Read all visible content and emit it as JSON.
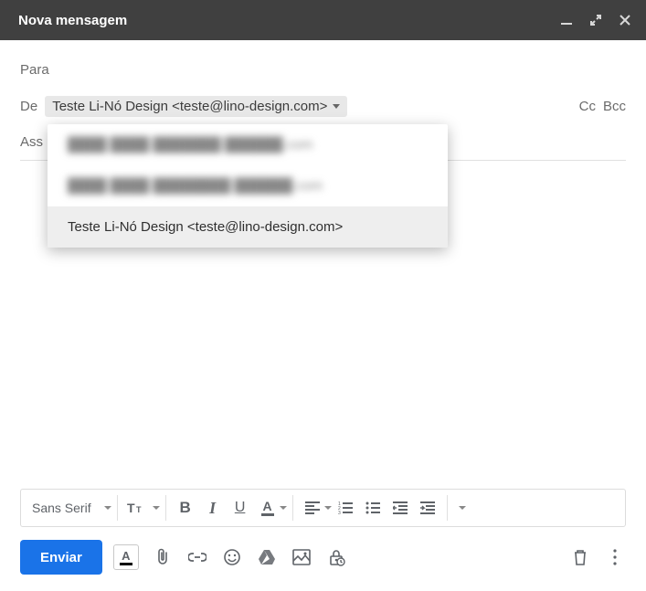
{
  "window": {
    "title": "Nova mensagem"
  },
  "fields": {
    "to_label": "Para",
    "from_label": "De",
    "subject_label": "Ass",
    "cc_label": "Cc",
    "bcc_label": "Bcc",
    "from_selected": "Teste Li-Nó Design <teste@lino-design.com>"
  },
  "from_dropdown": {
    "options": [
      {
        "label": "████ ████ ███████ ██████.com",
        "blurred": true
      },
      {
        "label": "████ ████ ████████ ██████.com",
        "blurred": true
      },
      {
        "label": "Teste Li-Nó Design <teste@lino-design.com>",
        "selected": true
      }
    ]
  },
  "format_toolbar": {
    "font": "Sans Serif"
  },
  "actions": {
    "send": "Enviar"
  },
  "icons": {
    "minimize": "minimize-icon",
    "expand": "expand-icon",
    "close": "close-icon",
    "chevron_down": "chevron-down-icon",
    "text_size": "text-size-icon",
    "bold": "bold-icon",
    "italic": "italic-icon",
    "underline": "underline-icon",
    "text_color": "text-color-icon",
    "align": "align-icon",
    "list_numbered": "numbered-list-icon",
    "list_bulleted": "bulleted-list-icon",
    "indent_decrease": "indent-decrease-icon",
    "indent_increase": "indent-increase-icon",
    "more": "more-icon",
    "format_mode": "format-mode-icon",
    "attach": "attach-icon",
    "link": "link-icon",
    "emoji": "emoji-icon",
    "drive": "drive-icon",
    "image": "image-icon",
    "confidential": "confidential-icon",
    "trash": "trash-icon",
    "overflow": "overflow-icon"
  }
}
